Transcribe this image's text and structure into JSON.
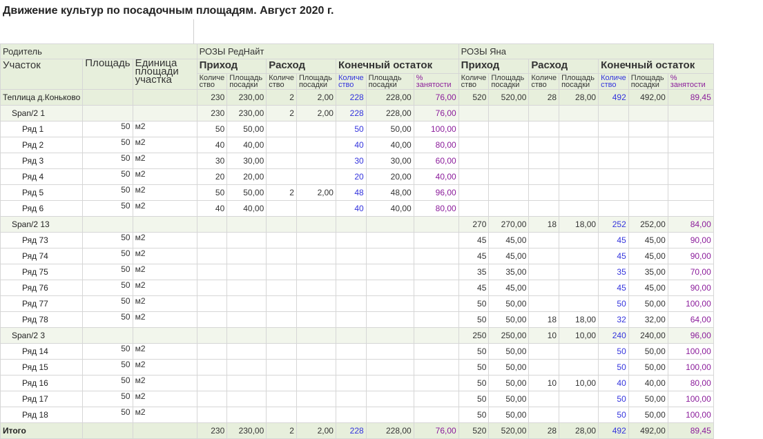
{
  "title": "Движение культур по посадочным площадям. Август 2020 г.",
  "header": {
    "parent": "Родитель",
    "area_name": "Участок",
    "size": "Площадь",
    "unit": "Единица площади участка",
    "groups": [
      "РОЗЫ РедНайт",
      "РОЗЫ Яна"
    ],
    "sub": [
      "Приход",
      "Расход",
      "Конечный остаток"
    ],
    "cols": [
      "Количе ство",
      "Площадь посадки",
      "Количе ство",
      "Площадь посадки",
      "Количе ство",
      "Площадь посадки",
      "% занятости"
    ]
  },
  "rows": [
    {
      "level": "block",
      "label": "Теплица д.Коньково",
      "size": "",
      "unit": "",
      "v": [
        "230",
        "230,00",
        "2",
        "2,00",
        "228",
        "228,00",
        "76,00",
        "520",
        "520,00",
        "28",
        "28,00",
        "492",
        "492,00",
        "89,45"
      ]
    },
    {
      "level": "span",
      "label": "Span/2 1",
      "size": "",
      "unit": "",
      "v": [
        "230",
        "230,00",
        "2",
        "2,00",
        "228",
        "228,00",
        "76,00",
        "",
        "",
        "",
        "",
        "",
        "",
        ""
      ]
    },
    {
      "level": "row",
      "label": "Ряд 1",
      "size": "50",
      "unit": "м2",
      "v": [
        "50",
        "50,00",
        "",
        "",
        "50",
        "50,00",
        "100,00",
        "",
        "",
        "",
        "",
        "",
        "",
        ""
      ]
    },
    {
      "level": "row",
      "label": "Ряд 2",
      "size": "50",
      "unit": "м2",
      "v": [
        "40",
        "40,00",
        "",
        "",
        "40",
        "40,00",
        "80,00",
        "",
        "",
        "",
        "",
        "",
        "",
        ""
      ]
    },
    {
      "level": "row",
      "label": "Ряд 3",
      "size": "50",
      "unit": "м2",
      "v": [
        "30",
        "30,00",
        "",
        "",
        "30",
        "30,00",
        "60,00",
        "",
        "",
        "",
        "",
        "",
        "",
        ""
      ]
    },
    {
      "level": "row",
      "label": "Ряд 4",
      "size": "50",
      "unit": "м2",
      "v": [
        "20",
        "20,00",
        "",
        "",
        "20",
        "20,00",
        "40,00",
        "",
        "",
        "",
        "",
        "",
        "",
        ""
      ]
    },
    {
      "level": "row",
      "label": "Ряд 5",
      "size": "50",
      "unit": "м2",
      "v": [
        "50",
        "50,00",
        "2",
        "2,00",
        "48",
        "48,00",
        "96,00",
        "",
        "",
        "",
        "",
        "",
        "",
        ""
      ]
    },
    {
      "level": "row",
      "label": "Ряд 6",
      "size": "50",
      "unit": "м2",
      "v": [
        "40",
        "40,00",
        "",
        "",
        "40",
        "40,00",
        "80,00",
        "",
        "",
        "",
        "",
        "",
        "",
        ""
      ]
    },
    {
      "level": "span",
      "label": "Span/2 13",
      "size": "",
      "unit": "",
      "v": [
        "",
        "",
        "",
        "",
        "",
        "",
        "",
        "270",
        "270,00",
        "18",
        "18,00",
        "252",
        "252,00",
        "84,00"
      ]
    },
    {
      "level": "row",
      "label": "Ряд 73",
      "size": "50",
      "unit": "м2",
      "v": [
        "",
        "",
        "",
        "",
        "",
        "",
        "",
        "45",
        "45,00",
        "",
        "",
        "45",
        "45,00",
        "90,00"
      ]
    },
    {
      "level": "row",
      "label": "Ряд 74",
      "size": "50",
      "unit": "м2",
      "v": [
        "",
        "",
        "",
        "",
        "",
        "",
        "",
        "45",
        "45,00",
        "",
        "",
        "45",
        "45,00",
        "90,00"
      ]
    },
    {
      "level": "row",
      "label": "Ряд 75",
      "size": "50",
      "unit": "м2",
      "v": [
        "",
        "",
        "",
        "",
        "",
        "",
        "",
        "35",
        "35,00",
        "",
        "",
        "35",
        "35,00",
        "70,00"
      ]
    },
    {
      "level": "row",
      "label": "Ряд 76",
      "size": "50",
      "unit": "м2",
      "v": [
        "",
        "",
        "",
        "",
        "",
        "",
        "",
        "45",
        "45,00",
        "",
        "",
        "45",
        "45,00",
        "90,00"
      ]
    },
    {
      "level": "row",
      "label": "Ряд 77",
      "size": "50",
      "unit": "м2",
      "v": [
        "",
        "",
        "",
        "",
        "",
        "",
        "",
        "50",
        "50,00",
        "",
        "",
        "50",
        "50,00",
        "100,00"
      ]
    },
    {
      "level": "row",
      "label": "Ряд 78",
      "size": "50",
      "unit": "м2",
      "v": [
        "",
        "",
        "",
        "",
        "",
        "",
        "",
        "50",
        "50,00",
        "18",
        "18,00",
        "32",
        "32,00",
        "64,00"
      ]
    },
    {
      "level": "span",
      "label": "Span/2 3",
      "size": "",
      "unit": "",
      "v": [
        "",
        "",
        "",
        "",
        "",
        "",
        "",
        "250",
        "250,00",
        "10",
        "10,00",
        "240",
        "240,00",
        "96,00"
      ]
    },
    {
      "level": "row",
      "label": "Ряд 14",
      "size": "50",
      "unit": "м2",
      "v": [
        "",
        "",
        "",
        "",
        "",
        "",
        "",
        "50",
        "50,00",
        "",
        "",
        "50",
        "50,00",
        "100,00"
      ]
    },
    {
      "level": "row",
      "label": "Ряд 15",
      "size": "50",
      "unit": "м2",
      "v": [
        "",
        "",
        "",
        "",
        "",
        "",
        "",
        "50",
        "50,00",
        "",
        "",
        "50",
        "50,00",
        "100,00"
      ]
    },
    {
      "level": "row",
      "label": "Ряд 16",
      "size": "50",
      "unit": "м2",
      "v": [
        "",
        "",
        "",
        "",
        "",
        "",
        "",
        "50",
        "50,00",
        "10",
        "10,00",
        "40",
        "40,00",
        "80,00"
      ]
    },
    {
      "level": "row",
      "label": "Ряд 17",
      "size": "50",
      "unit": "м2",
      "v": [
        "",
        "",
        "",
        "",
        "",
        "",
        "",
        "50",
        "50,00",
        "",
        "",
        "50",
        "50,00",
        "100,00"
      ]
    },
    {
      "level": "row",
      "label": "Ряд 18",
      "size": "50",
      "unit": "м2",
      "v": [
        "",
        "",
        "",
        "",
        "",
        "",
        "",
        "50",
        "50,00",
        "",
        "",
        "50",
        "50,00",
        "100,00"
      ]
    },
    {
      "level": "total",
      "label": "Итого",
      "size": "",
      "unit": "",
      "v": [
        "230",
        "230,00",
        "2",
        "2,00",
        "228",
        "228,00",
        "76,00",
        "520",
        "520,00",
        "28",
        "28,00",
        "492",
        "492,00",
        "89,45"
      ]
    }
  ],
  "colors": {
    "header_bg": "#e7efdc",
    "span_bg": "#f2f6ec",
    "blue": "#3333dd",
    "purple": "#8b1c9b"
  }
}
